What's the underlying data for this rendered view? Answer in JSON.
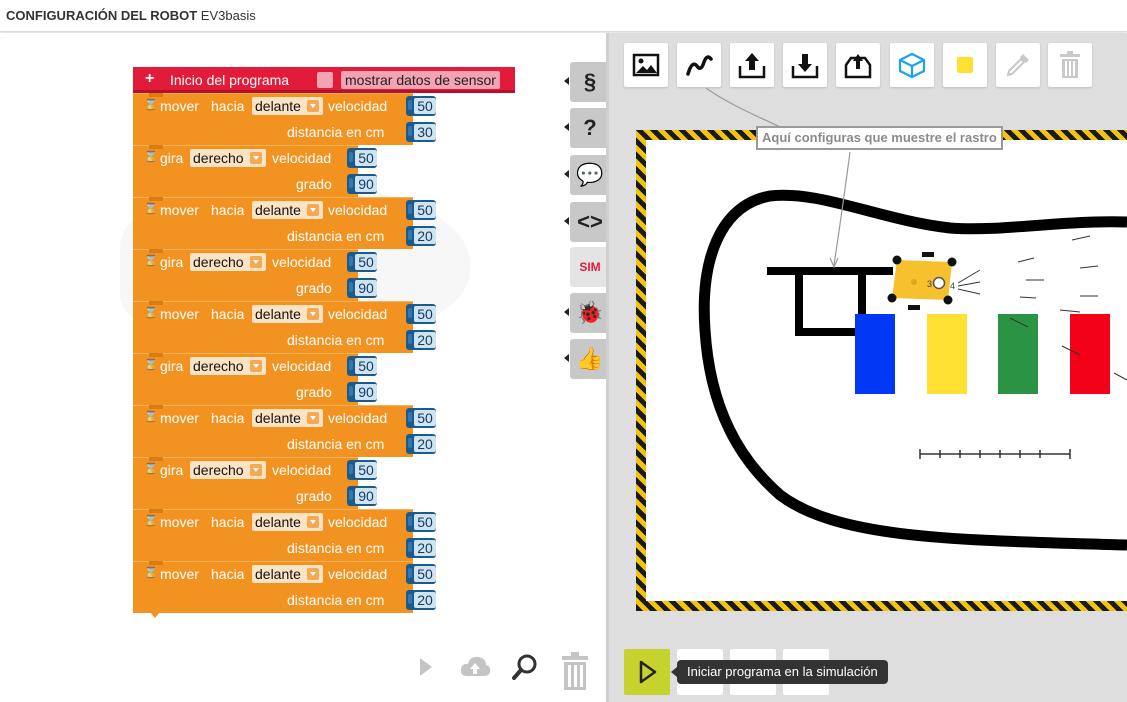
{
  "header": {
    "title_bold": "CONFIGURACIÓN DEL ROBOT",
    "title_robot": "EV3basis"
  },
  "program": {
    "start_label": "Inicio del programa",
    "sensor_label": "mostrar datos de sensor",
    "blocks": [
      {
        "kind": "mover",
        "action": "mover",
        "direction_word": "hacia",
        "direction": "delante",
        "speed_label": "velocidad",
        "speed": "50",
        "amount_label": "distancia en cm",
        "amount": "30"
      },
      {
        "kind": "gira",
        "action": "gira",
        "direction": "derecho",
        "speed_label": "velocidad",
        "speed": "50",
        "amount_label": "grado",
        "amount": "90"
      },
      {
        "kind": "mover",
        "action": "mover",
        "direction_word": "hacia",
        "direction": "delante",
        "speed_label": "velocidad",
        "speed": "50",
        "amount_label": "distancia en cm",
        "amount": "20"
      },
      {
        "kind": "gira",
        "action": "gira",
        "direction": "derecho",
        "speed_label": "velocidad",
        "speed": "50",
        "amount_label": "grado",
        "amount": "90"
      },
      {
        "kind": "mover",
        "action": "mover",
        "direction_word": "hacia",
        "direction": "delante",
        "speed_label": "velocidad",
        "speed": "50",
        "amount_label": "distancia en cm",
        "amount": "20"
      },
      {
        "kind": "gira",
        "action": "gira",
        "direction": "derecho",
        "speed_label": "velocidad",
        "speed": "50",
        "amount_label": "grado",
        "amount": "90"
      },
      {
        "kind": "mover",
        "action": "mover",
        "direction_word": "hacia",
        "direction": "delante",
        "speed_label": "velocidad",
        "speed": "50",
        "amount_label": "distancia en cm",
        "amount": "20"
      },
      {
        "kind": "gira",
        "action": "gira",
        "direction": "derecho",
        "speed_label": "velocidad",
        "speed": "50",
        "amount_label": "grado",
        "amount": "90"
      },
      {
        "kind": "mover",
        "action": "mover",
        "direction_word": "hacia",
        "direction": "delante",
        "speed_label": "velocidad",
        "speed": "50",
        "amount_label": "distancia en cm",
        "amount": "20"
      },
      {
        "kind": "mover",
        "action": "mover",
        "direction_word": "hacia",
        "direction": "delante",
        "speed_label": "velocidad",
        "speed": "50",
        "amount_label": "distancia en cm",
        "amount": "20"
      }
    ]
  },
  "palette": [
    {
      "name": "variables-category",
      "glyph": "§"
    },
    {
      "name": "help-category",
      "glyph": "?"
    },
    {
      "name": "chat-category",
      "glyph": "💬"
    },
    {
      "name": "code-view-category",
      "glyph": "<>"
    },
    {
      "name": "simulation-toggle",
      "glyph": "SIM"
    },
    {
      "name": "debug-category",
      "glyph": "🐞"
    },
    {
      "name": "feedback-category",
      "glyph": "👍"
    }
  ],
  "simulation": {
    "callout": "Aquí configuras que muestre el rastro",
    "tooltip": "Iniciar programa en la simulación",
    "robot_labels": {
      "left": "3",
      "right": "4"
    },
    "colors": {
      "accent": "#c5d32c",
      "block": "#f29321",
      "start": "#e21b3a",
      "blue": "#0038f5",
      "yellow": "#ffe134",
      "green": "#2b9344",
      "red": "#f30019"
    }
  }
}
